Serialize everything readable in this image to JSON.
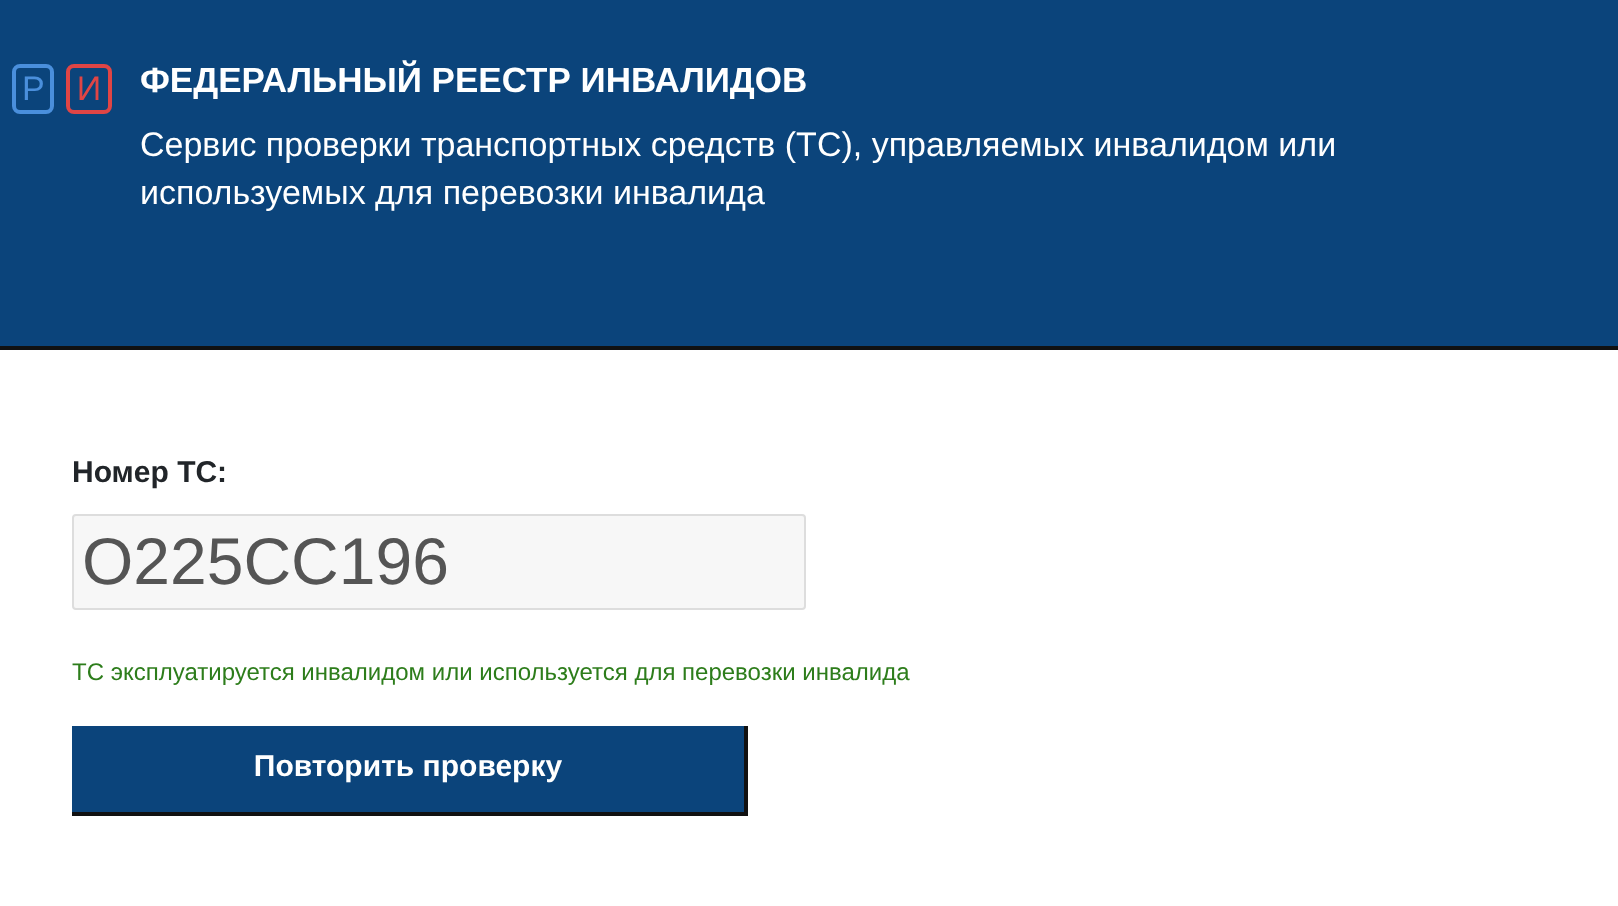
{
  "header": {
    "logo": [
      "Р",
      "И"
    ],
    "title": "ФЕДЕРАЛЬНЫЙ РЕЕСТР ИНВАЛИДОВ",
    "subtitle": "Сервис проверки транспортных средств (ТС), управляемых инвалидом или используемых для перевозки инвалида"
  },
  "form": {
    "label": "Номер ТС:",
    "value": "О225СС196",
    "result": "ТС эксплуатируется инвалидом или используется для перевозки инвалида",
    "button": "Повторить проверку"
  }
}
